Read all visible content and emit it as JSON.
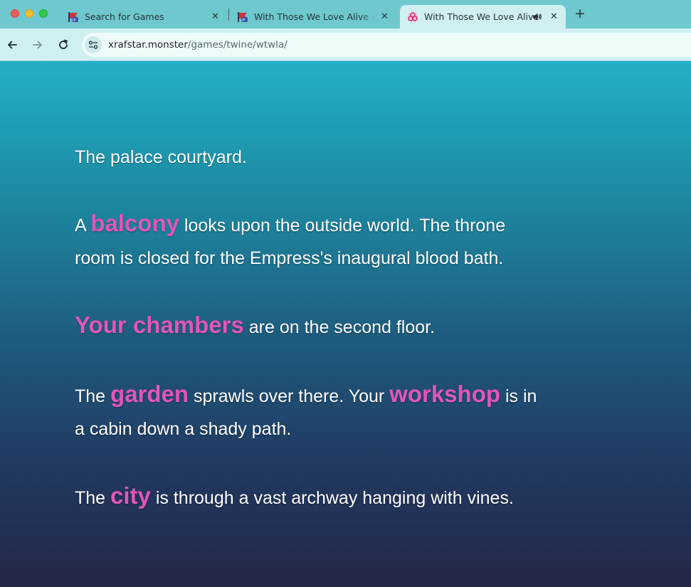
{
  "browser": {
    "tabs": [
      {
        "title": "Search for Games",
        "favicon": "ifdb-flag-icon",
        "active": false
      },
      {
        "title": "With Those We Love Alive - D",
        "favicon": "ifdb-flag-icon",
        "active": false
      },
      {
        "title": "With Those We Love Alive",
        "favicon": "biohazard-icon",
        "active": true,
        "audio": true
      }
    ],
    "url_host": "xrafstar.monster",
    "url_path": "/games/twine/wtwla/",
    "colors": {
      "tab_strip": "#6fc8cf",
      "toolbar": "#cfeff1"
    }
  },
  "story": {
    "p1": "The palace courtyard.",
    "p2": {
      "before": "A ",
      "link": "balcony",
      "after": " looks upon the outside world. The throne room is closed for the Empress's inaugural blood bath."
    },
    "p3": {
      "link": "Your chambers",
      "after": " are on the second floor."
    },
    "p4": {
      "before": "The ",
      "link1": "garden",
      "middle": " sprawls over there. Your ",
      "link2": "workshop",
      "after": " is in a cabin down a shady path."
    },
    "p5": {
      "before": "The ",
      "link": "city",
      "after": " is through a vast archway hanging with vines."
    },
    "colors": {
      "text": "#ffffff",
      "link": "#e256b8",
      "bg_top": "#22b0c6",
      "bg_bottom": "#232748"
    }
  }
}
